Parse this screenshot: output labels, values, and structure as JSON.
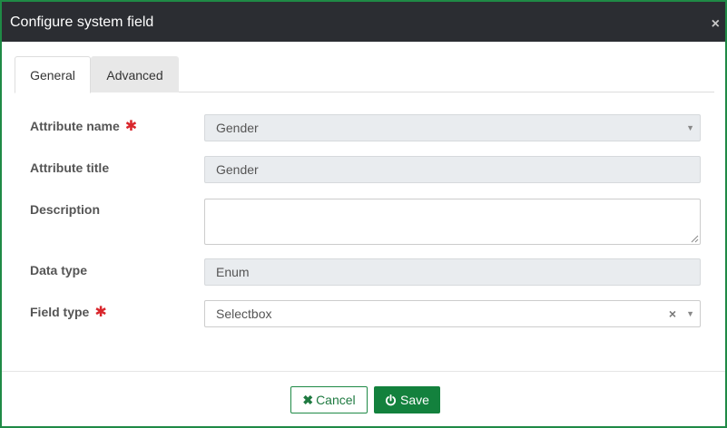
{
  "modal": {
    "title": "Configure system field",
    "close_glyph": "×"
  },
  "tabs": [
    {
      "label": "General",
      "active": true
    },
    {
      "label": "Advanced",
      "active": false
    }
  ],
  "form": {
    "attribute_name": {
      "label": "Attribute name",
      "required_mark": "✱",
      "value": "Gender"
    },
    "attribute_title": {
      "label": "Attribute title",
      "value": "Gender"
    },
    "description": {
      "label": "Description",
      "value": ""
    },
    "data_type": {
      "label": "Data type",
      "value": "Enum"
    },
    "field_type": {
      "label": "Field type",
      "required_mark": "✱",
      "value": "Selectbox",
      "clear_glyph": "×"
    }
  },
  "icons": {
    "caret": "▼",
    "cancel": "✖"
  },
  "footer": {
    "cancel_label": "Cancel",
    "save_label": "Save"
  },
  "colors": {
    "header_bg": "#2b2d32",
    "accent": "#13813d",
    "required": "#d9262c",
    "readonly_bg": "#e9ecef"
  }
}
